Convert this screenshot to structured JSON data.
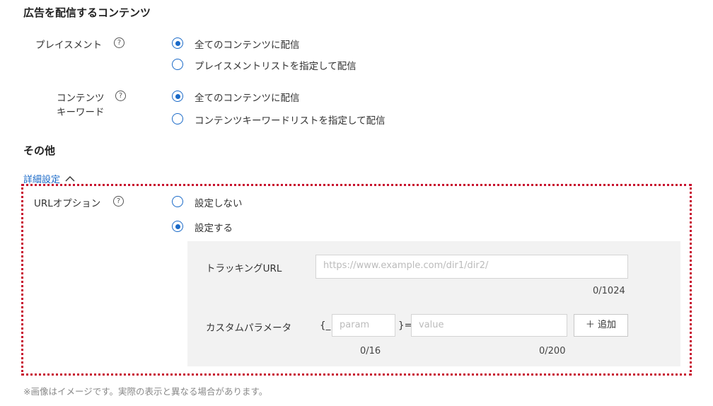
{
  "content_section": {
    "title": "広告を配信するコンテンツ",
    "placement": {
      "label": "プレイスメント",
      "help": "?",
      "options": [
        "全てのコンテンツに配信",
        "プレイスメントリストを指定して配信"
      ],
      "selected": 0
    },
    "keyword": {
      "label_line1": "コンテンツ",
      "label_line2": "キーワード",
      "help": "?",
      "options": [
        "全てのコンテンツに配信",
        "コンテンツキーワードリストを指定して配信"
      ],
      "selected": 0
    }
  },
  "other_section": {
    "title": "その他",
    "advanced_link": "詳細設定",
    "url_option": {
      "label": "URLオプション",
      "help": "?",
      "options": [
        "設定しない",
        "設定する"
      ],
      "selected": 1
    },
    "tracking": {
      "label": "トラッキングURL",
      "placeholder": "https://www.example.com/dir1/dir2/",
      "counter": "0/1024"
    },
    "custom_param": {
      "label": "カスタムパラメータ",
      "prefix": "{_",
      "param_placeholder": "param",
      "equals": "}=",
      "value_placeholder": "value",
      "add_label": "＋ 追加",
      "param_counter": "0/16",
      "value_counter": "0/200"
    }
  },
  "footnote": "※画像はイメージです。実際の表示と異なる場合があります。",
  "colors": {
    "accent": "#1a6ac8",
    "highlight_border": "#c8102e",
    "panel_bg": "#f2f2f2"
  }
}
